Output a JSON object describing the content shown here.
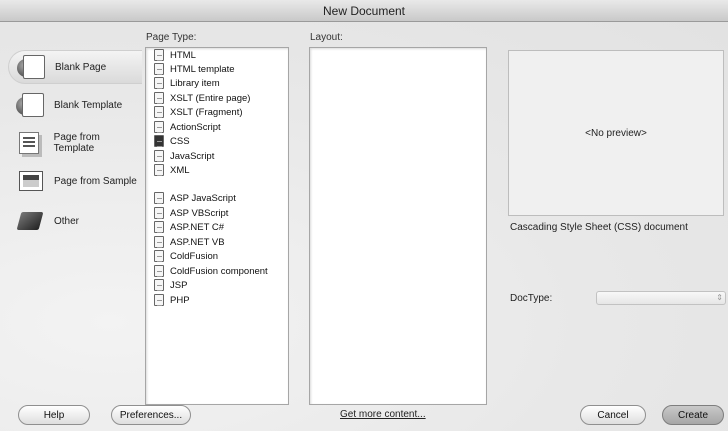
{
  "window": {
    "title": "New Document"
  },
  "categories": [
    {
      "label": "Blank Page",
      "icon": "blank-page-icon",
      "selected": true
    },
    {
      "label": "Blank Template",
      "icon": "blank-template-icon",
      "selected": false
    },
    {
      "label": "Page from Template",
      "icon": "page-from-template-icon",
      "selected": false
    },
    {
      "label": "Page from Sample",
      "icon": "page-from-sample-icon",
      "selected": false
    },
    {
      "label": "Other",
      "icon": "other-icon",
      "selected": false
    }
  ],
  "page_type": {
    "label": "Page Type:",
    "items": [
      "HTML",
      "HTML template",
      "Library item",
      "XSLT (Entire page)",
      "XSLT (Fragment)",
      "ActionScript",
      "CSS",
      "JavaScript",
      "XML",
      "ASP JavaScript",
      "ASP VBScript",
      "ASP.NET C#",
      "ASP.NET VB",
      "ColdFusion",
      "ColdFusion component",
      "JSP",
      "PHP"
    ],
    "selected": "CSS"
  },
  "layout": {
    "label": "Layout:"
  },
  "preview": {
    "text": "<No preview>"
  },
  "description": "Cascading Style Sheet (CSS) document",
  "doctype": {
    "label": "DocType:",
    "value": ""
  },
  "buttons": {
    "help": "Help",
    "preferences": "Preferences...",
    "get_more": "Get more content...",
    "cancel": "Cancel",
    "create": "Create"
  }
}
